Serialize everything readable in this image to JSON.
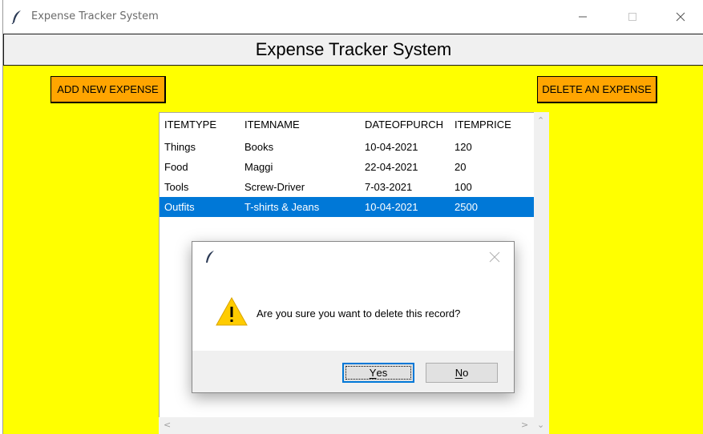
{
  "window": {
    "title": "Expense Tracker System",
    "icon": "feather-icon"
  },
  "header": {
    "title": "Expense Tracker System"
  },
  "toolbar": {
    "add_label": "ADD NEW EXPENSE",
    "delete_label": "DELETE AN EXPENSE"
  },
  "table": {
    "columns": [
      "ITEMTYPE",
      "ITEMNAME",
      "DATEOFPURCH",
      "ITEMPRICE"
    ],
    "rows": [
      [
        "Things",
        "Books",
        "10-04-2021",
        "120"
      ],
      [
        "Food",
        "Maggi",
        "22-04-2021",
        "20"
      ],
      [
        "Tools",
        "Screw-Driver",
        "7-03-2021",
        "100"
      ],
      [
        "Outfits",
        "T-shirts & Jeans",
        "10-04-2021",
        "2500"
      ]
    ],
    "selected_row": 3
  },
  "dialog": {
    "message": "Are you sure you want to delete this record?",
    "yes_first": "Y",
    "yes_rest": "es",
    "no_first": "N",
    "no_rest": "o",
    "icon": "warning-icon"
  },
  "colors": {
    "background": "#ffff00",
    "button": "#ffa500",
    "selection": "#0078d7"
  }
}
